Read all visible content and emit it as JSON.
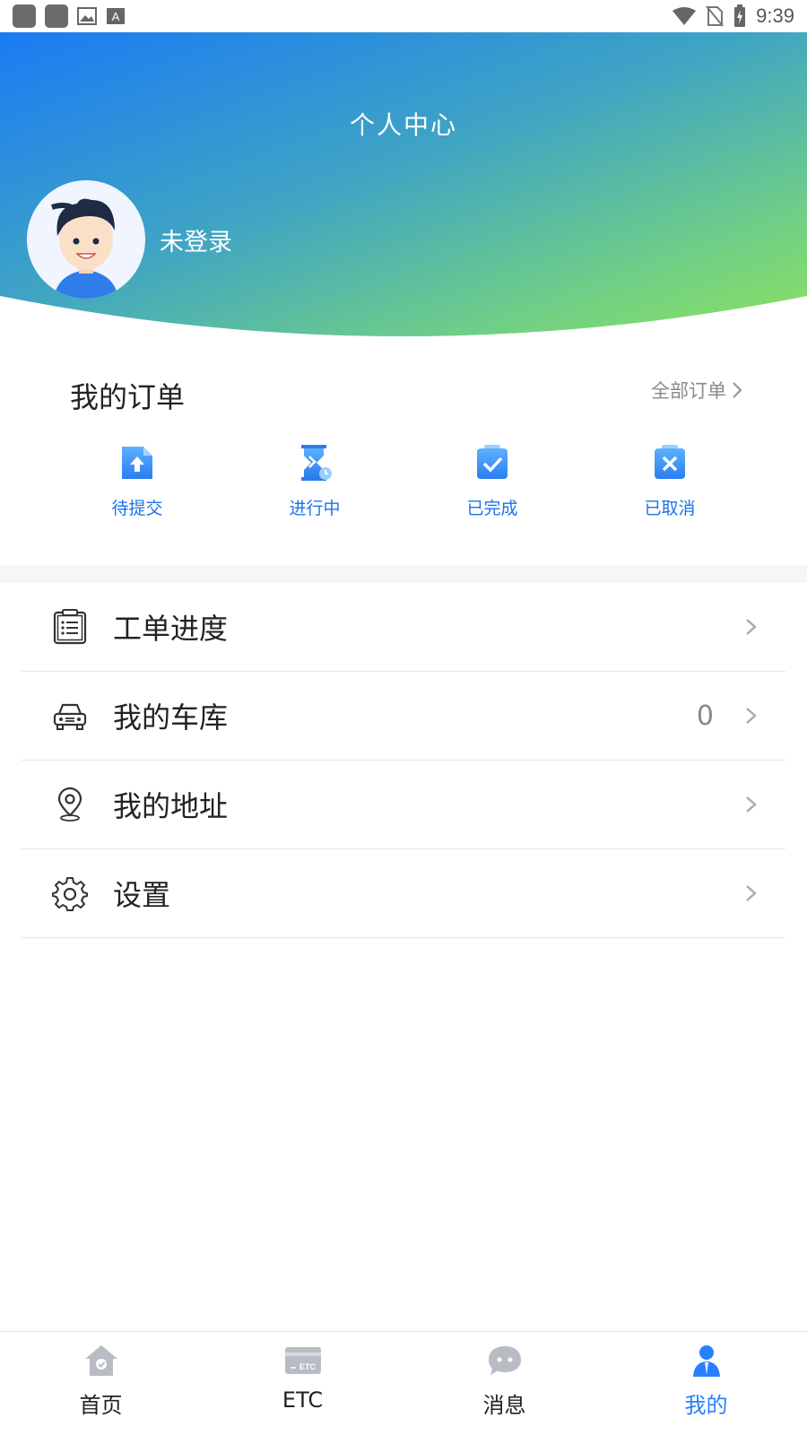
{
  "status_bar": {
    "time": "9:39"
  },
  "header": {
    "title": "个人中心",
    "login_status": "未登录"
  },
  "orders": {
    "title": "我的订单",
    "all_label": "全部订单",
    "items": [
      {
        "label": "待提交",
        "icon": "upload-doc-icon"
      },
      {
        "label": "进行中",
        "icon": "hourglass-icon"
      },
      {
        "label": "已完成",
        "icon": "check-doc-icon"
      },
      {
        "label": "已取消",
        "icon": "cancel-doc-icon"
      }
    ]
  },
  "menu": [
    {
      "label": "工单进度",
      "icon": "clipboard-list-icon",
      "value": ""
    },
    {
      "label": "我的车库",
      "icon": "car-icon",
      "value": "0"
    },
    {
      "label": "我的地址",
      "icon": "location-pin-icon",
      "value": ""
    },
    {
      "label": "设置",
      "icon": "gear-icon",
      "value": ""
    }
  ],
  "tabs": [
    {
      "label": "首页",
      "icon": "home-icon"
    },
    {
      "label": "ETC",
      "icon": "etc-card-icon"
    },
    {
      "label": "消息",
      "icon": "chat-bubble-icon"
    },
    {
      "label": "我的",
      "icon": "user-icon",
      "active": true
    }
  ],
  "colors": {
    "accent": "#2780ff",
    "gradient_start": "#1a7bf4",
    "gradient_end": "#8fe35b",
    "order_label": "#1a73e8"
  }
}
